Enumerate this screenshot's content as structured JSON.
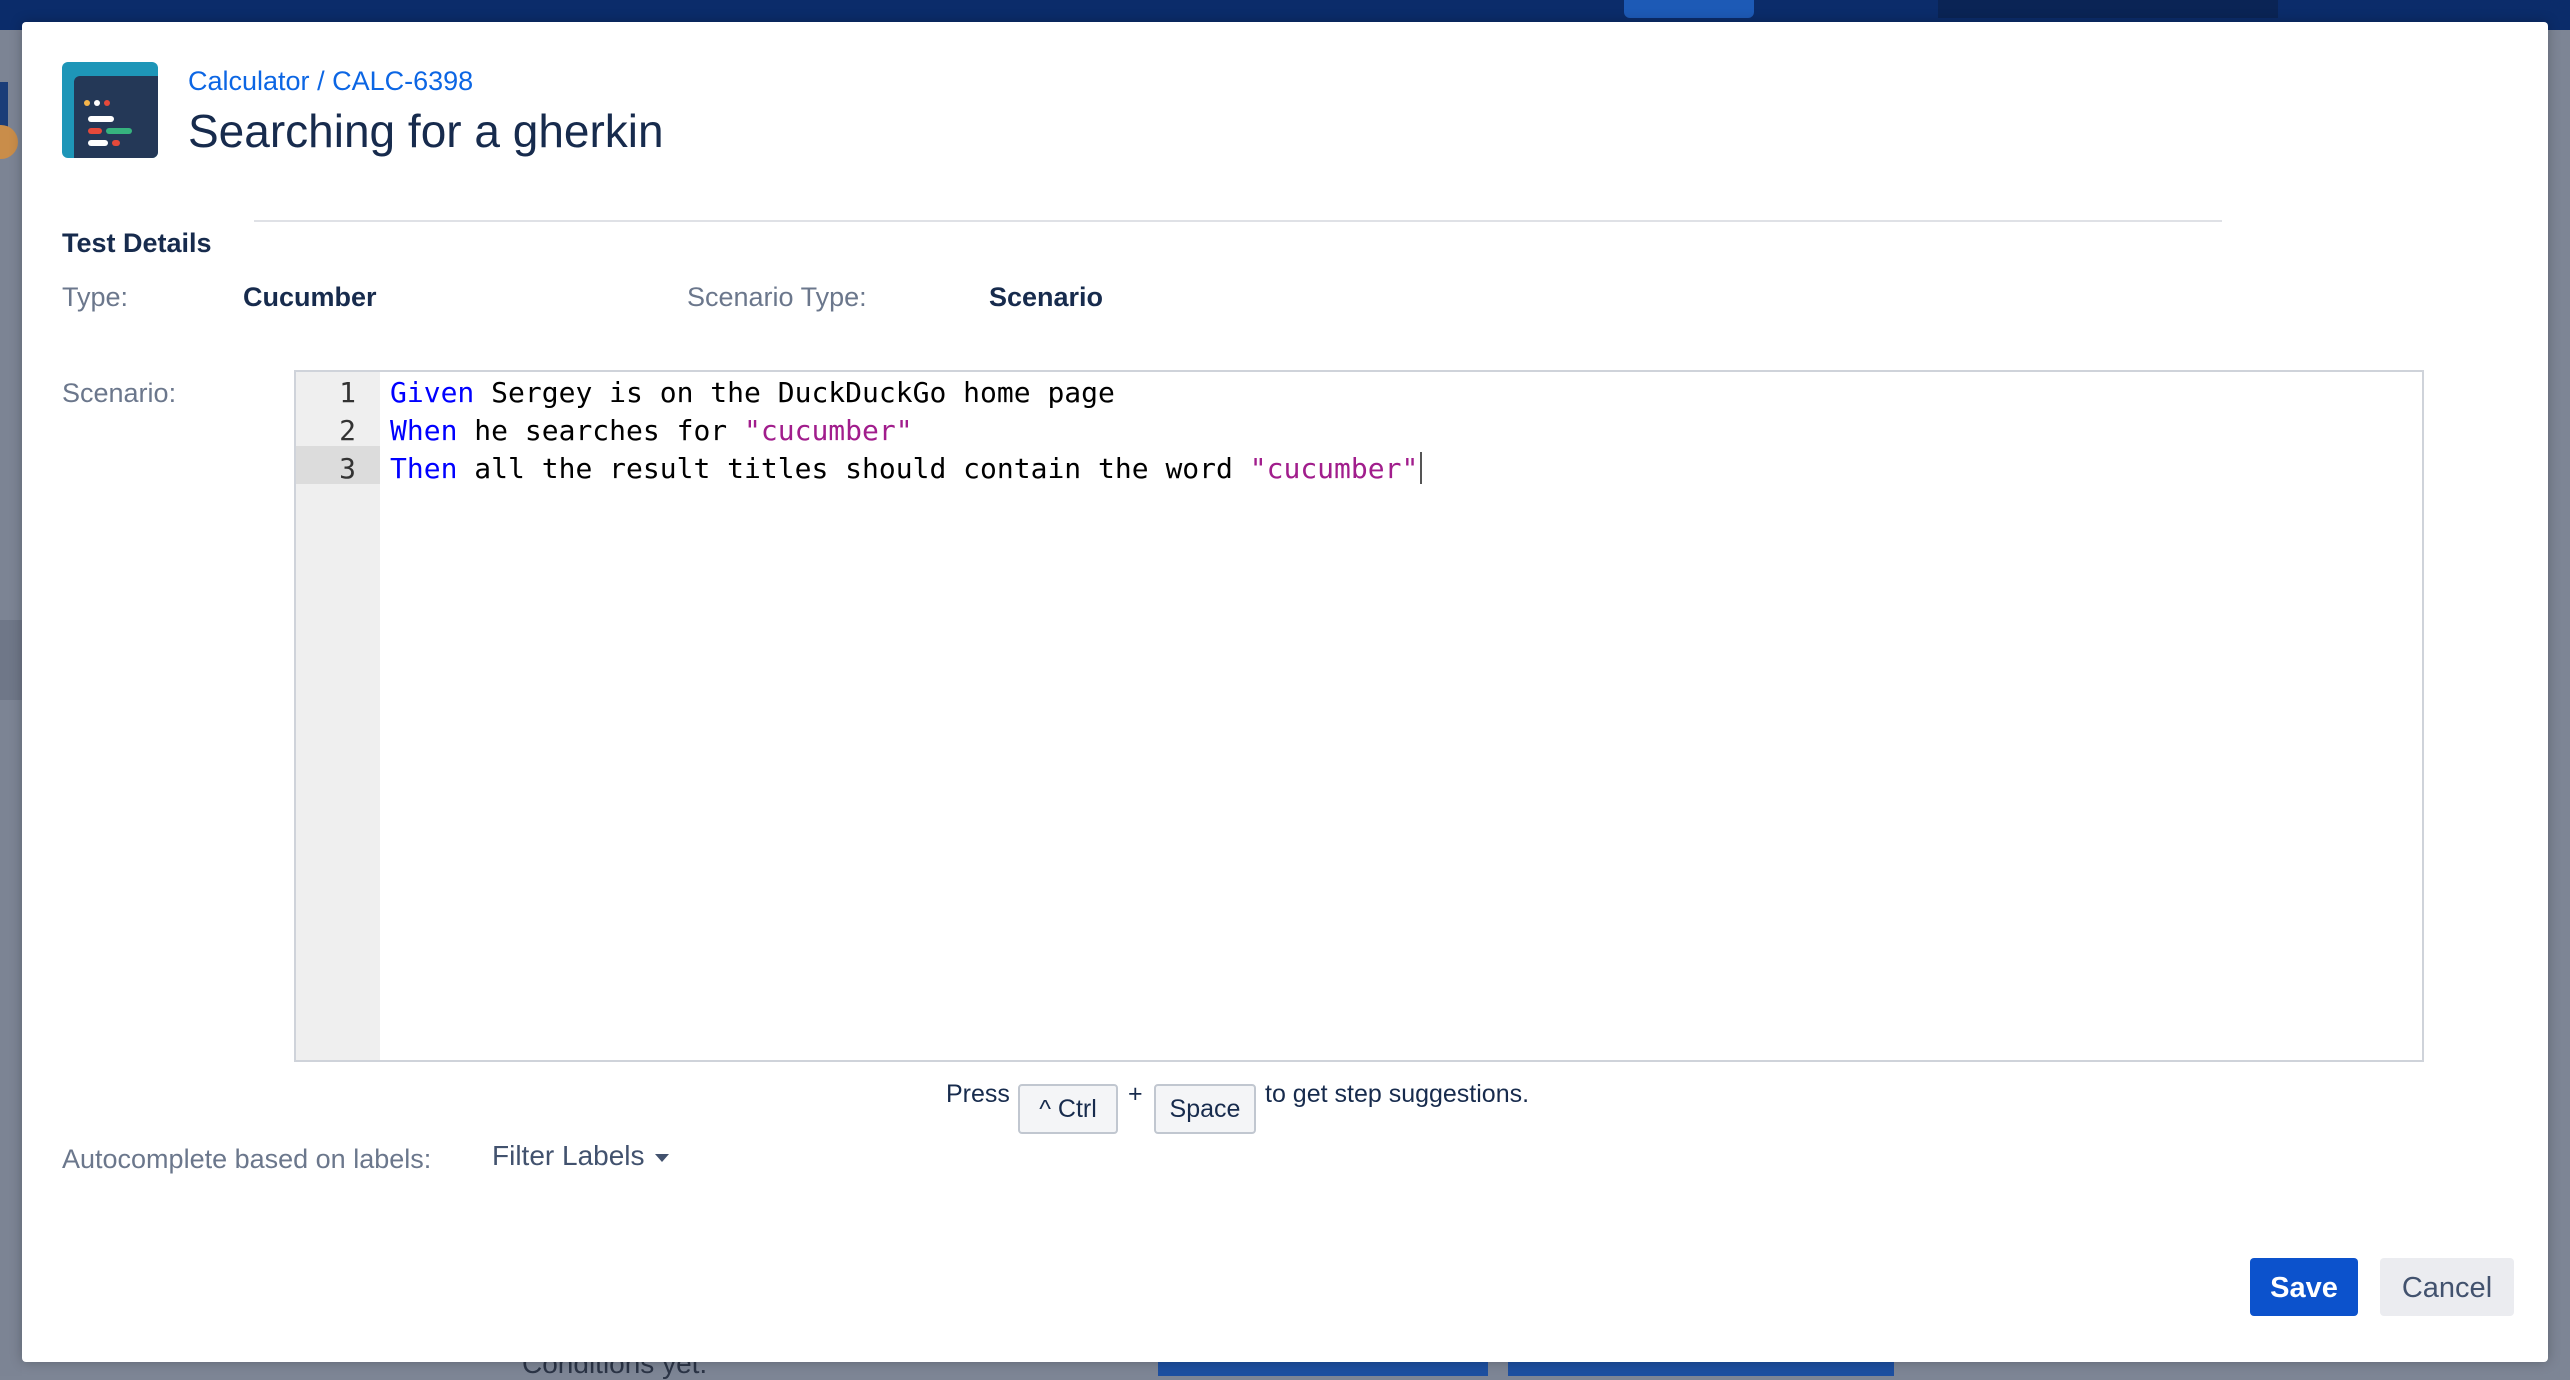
{
  "header": {
    "project_link": "Calculator",
    "separator": "/",
    "issue_key": "CALC-6398",
    "title": "Searching for a gherkin"
  },
  "details": {
    "section_title": "Test Details",
    "type_label": "Type:",
    "type_value": "Cucumber",
    "scenario_type_label": "Scenario Type:",
    "scenario_type_value": "Scenario",
    "scenario_label": "Scenario:"
  },
  "editor": {
    "lines": [
      {
        "number": "1",
        "keyword": "Given",
        "text_before": " Sergey is on the DuckDuckGo home page",
        "string": "",
        "text_after": ""
      },
      {
        "number": "2",
        "keyword": "When",
        "text_before": " he searches for ",
        "string": "\"cucumber\"",
        "text_after": ""
      },
      {
        "number": "3",
        "keyword": "Then",
        "text_before": " all the result titles should contain the word ",
        "string": "\"cucumber\"",
        "text_after": ""
      }
    ],
    "active_line": 3
  },
  "hint": {
    "press": "Press",
    "key1": "^ Ctrl",
    "plus": "+",
    "key2": "Space",
    "suffix": "to get step suggestions."
  },
  "autocomplete": {
    "label": "Autocomplete based on labels:",
    "filter_button": "Filter Labels"
  },
  "actions": {
    "save": "Save",
    "cancel": "Cancel"
  },
  "background": {
    "bottom_text": "Conditions yet."
  },
  "colors": {
    "accent": "#0c52cc",
    "link": "#0c66e4",
    "keyword": "#0000ff",
    "string": "#a11d8c"
  }
}
